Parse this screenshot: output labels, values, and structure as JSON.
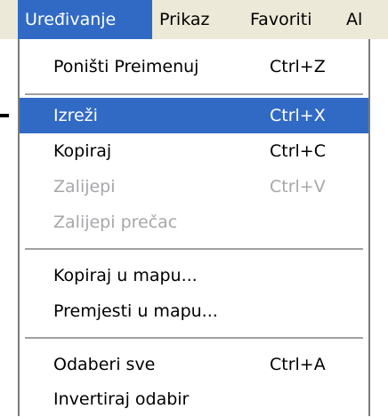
{
  "menubar": {
    "items": [
      {
        "label": "Uređivanje"
      },
      {
        "label": "Prikaz"
      },
      {
        "label": "Favoriti"
      },
      {
        "label": "Al"
      }
    ]
  },
  "menu": {
    "items": [
      {
        "label": "Poništi Preimenuj",
        "shortcut": "Ctrl+Z",
        "state": "normal"
      },
      {
        "label": "Izreži",
        "shortcut": "Ctrl+X",
        "state": "selected"
      },
      {
        "label": "Kopiraj",
        "shortcut": "Ctrl+C",
        "state": "normal"
      },
      {
        "label": "Zalijepi",
        "shortcut": "Ctrl+V",
        "state": "disabled"
      },
      {
        "label": "Zalijepi prečac",
        "shortcut": "",
        "state": "disabled"
      },
      {
        "label": "Kopiraj u mapu...",
        "shortcut": "",
        "state": "normal"
      },
      {
        "label": "Premjesti u mapu...",
        "shortcut": "",
        "state": "normal"
      },
      {
        "label": "Odaberi sve",
        "shortcut": "Ctrl+A",
        "state": "normal"
      },
      {
        "label": "Invertiraj odabir",
        "shortcut": "",
        "state": "normal"
      }
    ]
  },
  "colors": {
    "highlight": "#316ac5",
    "menubar_bg": "#ece9d8",
    "disabled_text": "#a7a6aa"
  }
}
